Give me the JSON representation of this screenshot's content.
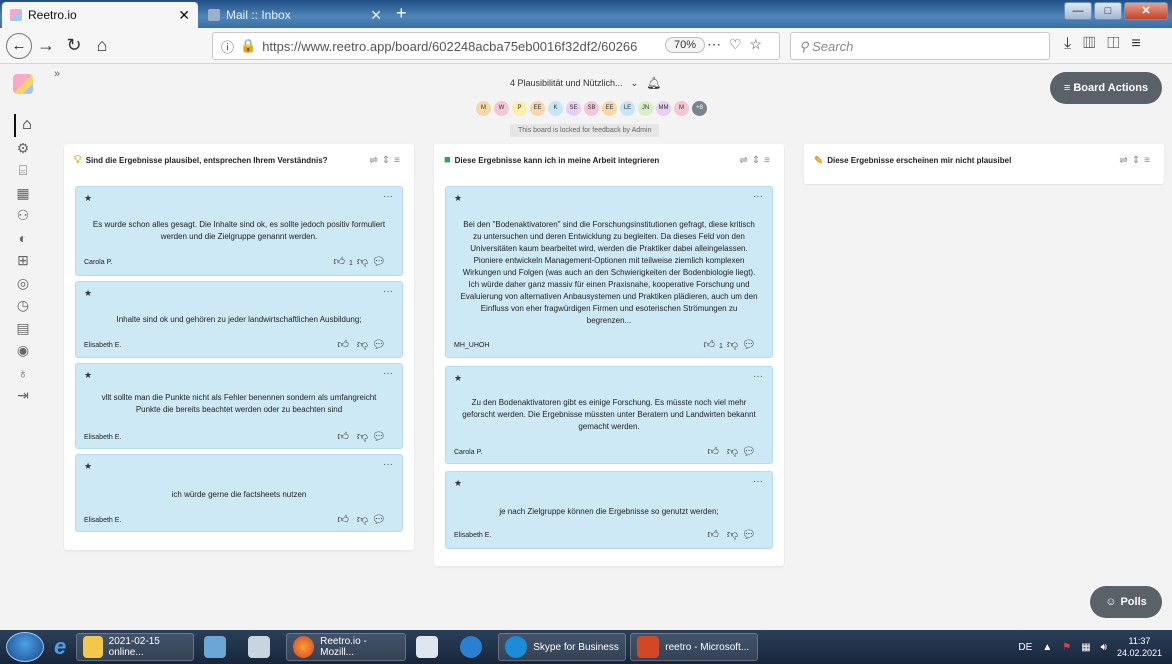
{
  "browser": {
    "tabs": [
      {
        "title": "Reetro.io",
        "active": true
      },
      {
        "title": "Mail :: Inbox",
        "active": false
      }
    ],
    "url": "https://www.reetro.app/board/602248acba75eb0016f32df2/60266",
    "zoom": "70%",
    "search_placeholder": "Search"
  },
  "board": {
    "title": "4 Plausibilität und Nützlich...",
    "participants": [
      "M",
      "W",
      "P",
      "EE",
      "K",
      "SE",
      "SB",
      "EE",
      "LE",
      "JN",
      "MM",
      "M",
      "+8"
    ],
    "participant_colors": [
      "#f6d8a8",
      "#f4c6d6",
      "#f6f0a8",
      "#f6d8a8",
      "#c6e6f6",
      "#e6d0f4",
      "#f4c6d6",
      "#f6d8a8",
      "#c6e6f6",
      "#d6f0c6",
      "#e6d0f4",
      "#f4c6d6",
      "#7a848c"
    ],
    "locked_notice": "This board is locked for feedback by Admin",
    "actions_label": "≡ Board Actions",
    "polls_label": "Polls"
  },
  "columns": [
    {
      "title": "Sind die Ergebnisse plausibel, entsprechen Ihrem Verständnis?",
      "icon": "lightbulb-icon",
      "cards": [
        {
          "text": "Es wurde schon alles gesagt. Die Inhalte sind ok, es sollte jedoch positiv formuliert werden und die Zielgruppe genannt werden.",
          "author": "Carola P.",
          "likes": "1"
        },
        {
          "text": "Inhalte sind ok und gehören zu jeder landwirtschaftlichen Ausbildung;",
          "author": "Elisabeth E.",
          "likes": ""
        },
        {
          "text": "vllt sollte man die Punkte nicht als Fehler benennen sondern als umfangreicht Punkte die bereits beachtet werden oder zu beachten sind",
          "author": "Elisabeth E.",
          "likes": ""
        },
        {
          "text": "ich würde gerne die factsheets nutzen",
          "author": "Elisabeth E.",
          "likes": ""
        }
      ]
    },
    {
      "title": "Diese Ergebnisse kann ich in meine Arbeit integrieren",
      "icon": "green-square-icon",
      "cards": [
        {
          "text": "Bei den \"Bodenaktivatoren\" sind die Forschungsinstitutionen gefragt, diese kritisch zu untersuchen und deren Entwicklung zu begleiten. Da dieses Feld von den Universitäten kaum bearbeitet wird, werden die Praktiker dabei alleingelassen. Pioniere entwickeln Management-Optionen mit teilweise ziemlich komplexen Wirkungen und Folgen (was auch an den Schwierigkeiten der Bodenbiologie liegt). Ich würde daher ganz massiv für einen Praxisnahe, kooperative Forschung und Evaluierung von alternativen Anbausystemen und Praktiken plädieren, auch um den Einfluss von eher fragwürdigen Firmen und esoterischen Strömungen zu begrenzen...",
          "author": "MH_UHOH",
          "likes": "1"
        },
        {
          "text": "Zu den Bodenaktivatoren gibt es einige Forschung. Es müsste noch viel mehr geforscht werden. Die Ergebnisse müssten unter Beratern und Landwirten bekannt gemacht werden.",
          "author": "Carola P.",
          "likes": ""
        },
        {
          "text": "je nach Zielgruppe können die Ergebnisse so genutzt werden;",
          "author": "Elisabeth E.",
          "likes": ""
        }
      ]
    },
    {
      "title": "Diese Ergebnisse erscheinen mir nicht plausibel",
      "icon": "pencil-icon",
      "cards": []
    }
  ],
  "taskbar": {
    "items": [
      "2021-02-15 online...",
      "Reetro.io - Mozill...",
      "Skype for Business",
      "reetro - Microsoft..."
    ],
    "language": "DE",
    "time": "11:37",
    "date": "24.02.2021"
  }
}
